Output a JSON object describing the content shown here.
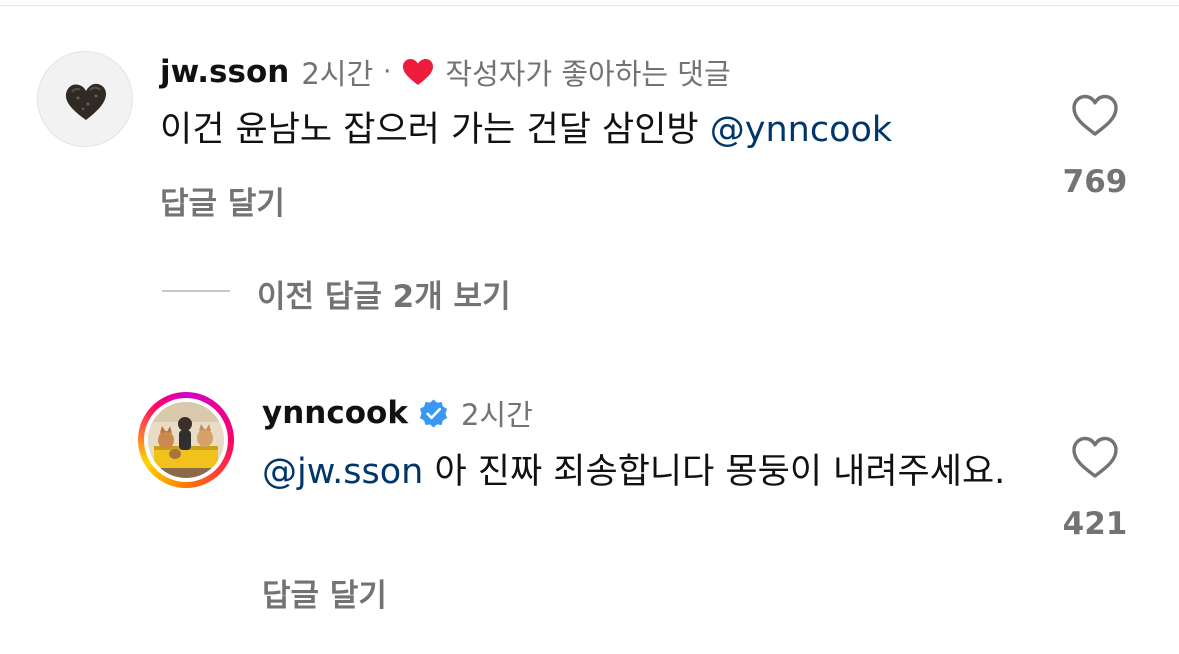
{
  "comments": [
    {
      "username": "jw.sson",
      "time": "2시간",
      "separator": "·",
      "creator_liked_label": "작성자가 좋아하는 댓글",
      "text": "이건 윤남노 잡으러 가는 건달 삼인방 ",
      "mention": "@ynncook",
      "reply_label": "답글 달기",
      "like_count": "769",
      "avatar_icon": "heart-shaped-object-avatar"
    },
    {
      "username": "ynncook",
      "verified": true,
      "time": "2시간",
      "mention": "@jw.sson",
      "text": " 아 진짜 죄송합니다 몽둥이 내려주세요.",
      "reply_label": "답글 달기",
      "like_count": "421",
      "avatar_icon": "dogs-and-person-photo-avatar"
    }
  ],
  "view_previous": {
    "label": "이전 답글 2개 보기"
  },
  "colors": {
    "mention": "#00376b",
    "secondary_text": "#737373",
    "creator_heart": "#ed1c3a",
    "verified_badge": "#3897f0"
  }
}
